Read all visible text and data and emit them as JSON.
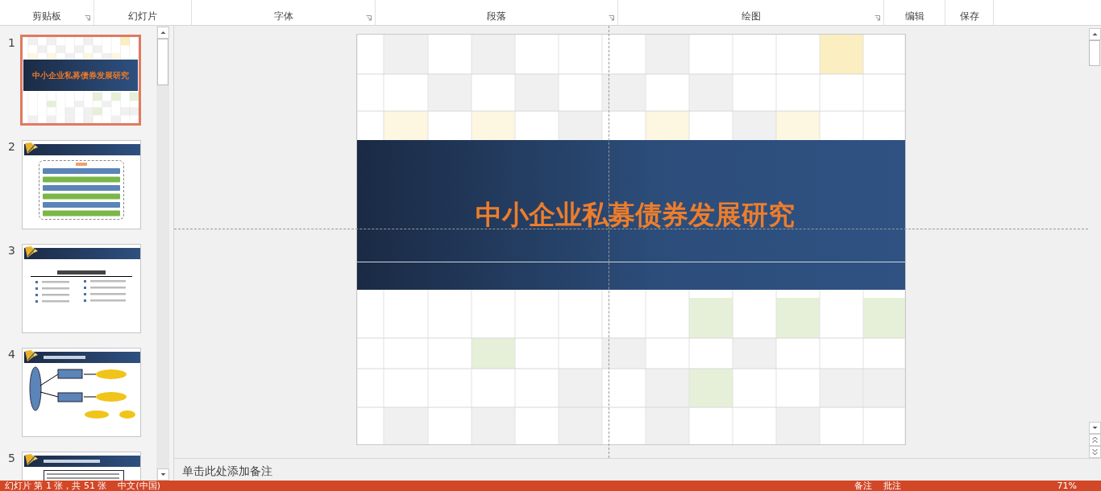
{
  "ribbon": {
    "groups": [
      {
        "label": "剪贴板",
        "launcher": true
      },
      {
        "label": "幻灯片",
        "launcher": false
      },
      {
        "label": "字体",
        "launcher": true
      },
      {
        "label": "段落",
        "launcher": true
      },
      {
        "label": "绘图",
        "launcher": true
      },
      {
        "label": "编辑",
        "launcher": false
      },
      {
        "label": "保存",
        "launcher": false
      }
    ]
  },
  "slides": [
    {
      "number": "1",
      "kind": "title",
      "title": "中小企业私募债券发展研究",
      "selected": true
    },
    {
      "number": "2",
      "kind": "agenda",
      "selected": false
    },
    {
      "number": "3",
      "kind": "overview",
      "selected": false
    },
    {
      "number": "4",
      "kind": "diagram",
      "selected": false
    },
    {
      "number": "5",
      "kind": "text",
      "selected": false
    }
  ],
  "slide": {
    "title": "中小企业私募债券发展研究"
  },
  "notes": {
    "placeholder": "单击此处添加备注"
  },
  "status_bar": {
    "left": [
      "幻灯片 第 1 张，共 51 张",
      "中文(中国)"
    ],
    "right": [
      "备注",
      "批注"
    ],
    "zoom": "71%"
  }
}
